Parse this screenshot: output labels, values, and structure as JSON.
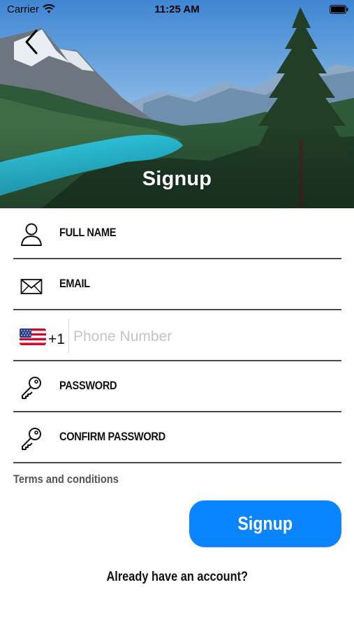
{
  "status_bar": {
    "carrier": "Carrier",
    "time": "11:25 AM"
  },
  "header": {
    "title": "Signup",
    "back_icon": "chevron-left-icon"
  },
  "form": {
    "full_name_label": "FULL NAME",
    "email_label": "EMAIL",
    "phone": {
      "country_flag": "us-flag-icon",
      "country_code": "+1",
      "placeholder": "Phone Number",
      "value": ""
    },
    "password_label": "PASSWORD",
    "confirm_password_label": "CONFIRM PASSWORD"
  },
  "terms_link": "Terms and conditions",
  "signup_button": "Signup",
  "login_link": "Already have an account?",
  "colors": {
    "accent": "#0a84ff",
    "divider": "#4a4a4a",
    "placeholder": "#c4c4c4"
  }
}
